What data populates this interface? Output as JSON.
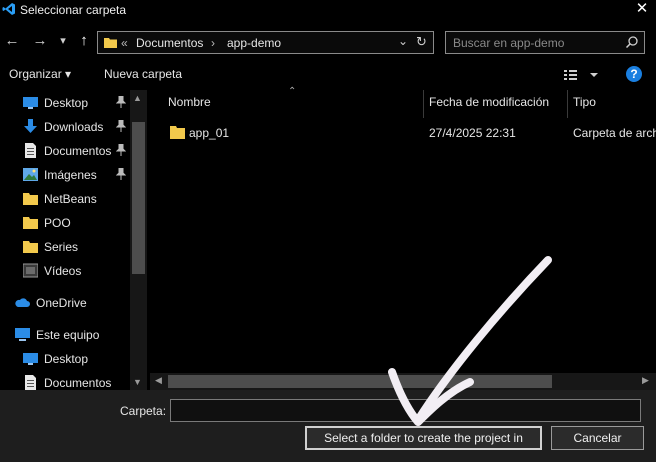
{
  "window": {
    "title": "Seleccionar carpeta",
    "close_glyph": "✕"
  },
  "nav": {
    "back_glyph": "←",
    "forward_glyph": "→",
    "recent_glyph": "▾",
    "up_glyph": "↑",
    "breadcrumb_overflow": "«",
    "breadcrumb": [
      "Documentos",
      "app-demo"
    ],
    "breadcrumb_separator": "›",
    "dropdown_glyph": "⌄",
    "refresh_glyph": "↻",
    "search_placeholder": "Buscar en app-demo"
  },
  "toolbar": {
    "organize_label": "Organizar ▾",
    "new_folder_label": "Nueva carpeta",
    "help_label": "?"
  },
  "sidebar": {
    "items": [
      {
        "label": "Desktop",
        "icon": "desktop-icon",
        "pinned": true
      },
      {
        "label": "Downloads",
        "icon": "download-icon",
        "pinned": true
      },
      {
        "label": "Documentos",
        "icon": "document-icon",
        "pinned": true
      },
      {
        "label": "Imágenes",
        "icon": "image-icon",
        "pinned": true
      },
      {
        "label": "NetBeans",
        "icon": "folder-icon",
        "pinned": false
      },
      {
        "label": "POO",
        "icon": "folder-icon",
        "pinned": false
      },
      {
        "label": "Series",
        "icon": "folder-icon",
        "pinned": false
      },
      {
        "label": "Vídeos",
        "icon": "video-icon",
        "pinned": false
      },
      {
        "label": "OneDrive",
        "icon": "cloud-icon",
        "pinned": false
      },
      {
        "label": "Este equipo",
        "icon": "computer-icon",
        "pinned": false
      },
      {
        "label": "Desktop",
        "icon": "desktop-icon",
        "pinned": false
      },
      {
        "label": "Documentos",
        "icon": "document-icon",
        "pinned": false
      }
    ]
  },
  "files": {
    "columns": [
      "Nombre",
      "Fecha de modificación",
      "Tipo"
    ],
    "rows": [
      {
        "name": "app_01",
        "date": "27/4/2025 22:31",
        "type": "Carpeta de archivos"
      }
    ]
  },
  "footer": {
    "folder_label": "Carpeta:",
    "folder_value": "",
    "select_button": "Select a folder to create the project in",
    "cancel_button": "Cancelar"
  },
  "colors": {
    "accent": "#1a7fe0",
    "folder": "#f2c94c",
    "background": "#000000",
    "footer": "#1e1e1e"
  }
}
